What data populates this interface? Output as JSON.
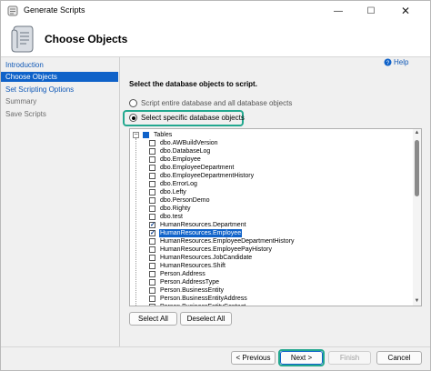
{
  "window": {
    "title": "Generate Scripts",
    "minimize_glyph": "—",
    "maximize_glyph": "☐",
    "close_glyph": "✕"
  },
  "header": {
    "title": "Choose Objects"
  },
  "nav": {
    "items": [
      {
        "label": "Introduction",
        "state": "link"
      },
      {
        "label": "Choose Objects",
        "state": "selected"
      },
      {
        "label": "Set Scripting Options",
        "state": "link"
      },
      {
        "label": "Summary",
        "state": "disabled"
      },
      {
        "label": "Save Scripts",
        "state": "disabled"
      }
    ]
  },
  "help": {
    "label": "Help"
  },
  "main": {
    "instruction": "Select the database objects to script.",
    "option_entire": "Script entire database and all database objects",
    "option_specific": "Select specific database objects",
    "selected_option": "specific"
  },
  "tree": {
    "root": {
      "label": "Tables",
      "expander": "−",
      "checked": "partial"
    },
    "items": [
      {
        "label": "dbo.AWBuildVersion",
        "checked": false,
        "selected": false
      },
      {
        "label": "dbo.DatabaseLog",
        "checked": false,
        "selected": false
      },
      {
        "label": "dbo.Employee",
        "checked": false,
        "selected": false
      },
      {
        "label": "dbo.EmployeeDepartment",
        "checked": false,
        "selected": false
      },
      {
        "label": "dbo.EmployeeDepartmentHistory",
        "checked": false,
        "selected": false
      },
      {
        "label": "dbo.ErrorLog",
        "checked": false,
        "selected": false
      },
      {
        "label": "dbo.Lefty",
        "checked": false,
        "selected": false
      },
      {
        "label": "dbo.PersonDemo",
        "checked": false,
        "selected": false
      },
      {
        "label": "dbo.Righty",
        "checked": false,
        "selected": false
      },
      {
        "label": "dbo.test",
        "checked": false,
        "selected": false
      },
      {
        "label": "HumanResources.Department",
        "checked": true,
        "selected": false
      },
      {
        "label": "HumanResources.Employee",
        "checked": true,
        "selected": true
      },
      {
        "label": "HumanResources.EmployeeDepartmentHistory",
        "checked": false,
        "selected": false
      },
      {
        "label": "HumanResources.EmployeePayHistory",
        "checked": false,
        "selected": false
      },
      {
        "label": "HumanResources.JobCandidate",
        "checked": false,
        "selected": false
      },
      {
        "label": "HumanResources.Shift",
        "checked": false,
        "selected": false
      },
      {
        "label": "Person.Address",
        "checked": false,
        "selected": false
      },
      {
        "label": "Person.AddressType",
        "checked": false,
        "selected": false
      },
      {
        "label": "Person.BusinessEntity",
        "checked": false,
        "selected": false
      },
      {
        "label": "Person.BusinessEntityAddress",
        "checked": false,
        "selected": false
      },
      {
        "label": "Person.BusinessEntityContact",
        "checked": false,
        "selected": false
      }
    ],
    "scroll_up_glyph": "▲",
    "scroll_down_glyph": "▼"
  },
  "buttons": {
    "select_all": "Select All",
    "deselect_all": "Deselect All",
    "previous": "< Previous",
    "next": "Next >",
    "finish": "Finish",
    "cancel": "Cancel"
  },
  "colors": {
    "accent": "#0f62c9",
    "link": "#0f58b6",
    "highlight": "#23a88f"
  }
}
